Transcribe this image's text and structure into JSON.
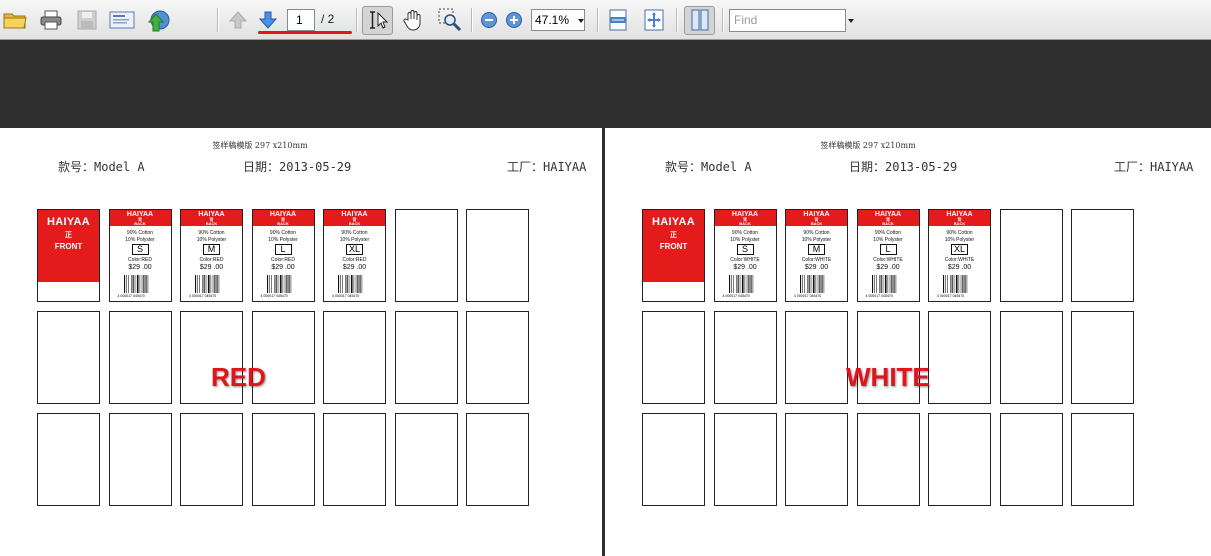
{
  "toolbar": {
    "page_current": "1",
    "page_total": "/ 2",
    "zoom": "47.1%",
    "find_placeholder": "Find",
    "icons": [
      "open-folder-icon",
      "print-icon",
      "save-icon",
      "email-icon",
      "share-icon",
      "previous-page-icon",
      "next-page-icon",
      "select-tool-icon",
      "hand-tool-icon",
      "marquee-zoom-icon",
      "zoom-out-icon",
      "zoom-in-icon",
      "fit-width-icon",
      "fit-page-icon",
      "single-page-view-icon"
    ],
    "accent_underline": "#e3141c"
  },
  "pages": [
    {
      "header_small": "签样稿模版 297 x210mm",
      "style": "款号：Model A",
      "date": "日期：2013-05-29",
      "factory": "工厂：HAIYAA",
      "color_word": "RED",
      "front": {
        "brand": "HAIYAA",
        "zh": "正",
        "label": "FRONT"
      },
      "back_tags": [
        {
          "brand": "HAIYAA",
          "zh": "背",
          "back": "BACK",
          "comp1": "90% Cotton",
          "comp2": "10% Polyster",
          "size": "S",
          "color": "Color:RED",
          "price": "$29 .00",
          "barcode": "4 000017 045470"
        },
        {
          "brand": "HAIYAA",
          "zh": "背",
          "back": "BACK",
          "comp1": "90% Cotton",
          "comp2": "10% Polyster",
          "size": "M",
          "color": "Color:RED",
          "price": "$29 .00",
          "barcode": "4 000017 045470"
        },
        {
          "brand": "HAIYAA",
          "zh": "背",
          "back": "BACK",
          "comp1": "90% Cotton",
          "comp2": "10% Polyster",
          "size": "L",
          "color": "Color:RED",
          "price": "$29 .00",
          "barcode": "4 000017 045470"
        },
        {
          "brand": "HAIYAA",
          "zh": "背",
          "back": "BACK",
          "comp1": "90% Cotton",
          "comp2": "10% Polyster",
          "size": "XL",
          "color": "Color:RED",
          "price": "$29 .00",
          "barcode": "4 000017 045470"
        }
      ]
    },
    {
      "header_small": "签样稿模版 297 x210mm",
      "style": "款号：Model A",
      "date": "日期：2013-05-29",
      "factory": "工厂：HAIYAA",
      "color_word": "WHITE",
      "front": {
        "brand": "HAIYAA",
        "zh": "正",
        "label": "FRONT"
      },
      "back_tags": [
        {
          "brand": "HAIYAA",
          "zh": "背",
          "back": "BACK",
          "comp1": "90% Cotton",
          "comp2": "10% Polyster",
          "size": "S",
          "color": "Color:WHITE",
          "price": "$29 .00",
          "barcode": "4 000017 045470"
        },
        {
          "brand": "HAIYAA",
          "zh": "背",
          "back": "BACK",
          "comp1": "90% Cotton",
          "comp2": "10% Polyster",
          "size": "M",
          "color": "Color:WHITE",
          "price": "$29 .00",
          "barcode": "4 000017 045470"
        },
        {
          "brand": "HAIYAA",
          "zh": "背",
          "back": "BACK",
          "comp1": "90% Cotton",
          "comp2": "10% Polyster",
          "size": "L",
          "color": "Color:WHITE",
          "price": "$29 .00",
          "barcode": "4 000017 045470"
        },
        {
          "brand": "HAIYAA",
          "zh": "背",
          "back": "BACK",
          "comp1": "90% Cotton",
          "comp2": "10% Polyster",
          "size": "XL",
          "color": "Color:WHITE",
          "price": "$29 .00",
          "barcode": "4 000017 045470"
        }
      ]
    }
  ],
  "tag_colors": {
    "red": "#e31b1b"
  }
}
